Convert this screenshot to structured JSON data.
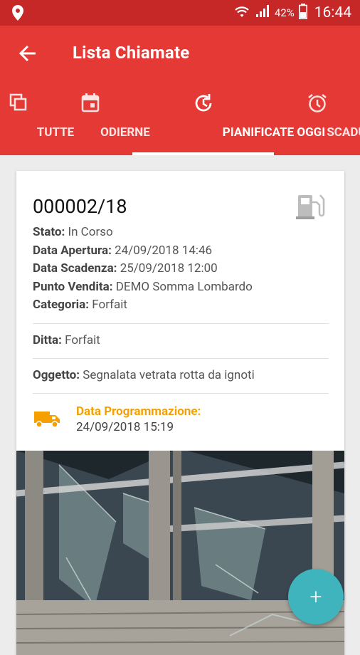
{
  "status_bar": {
    "battery_pct": "42%",
    "time": "16:44"
  },
  "app_bar": {
    "title": "Lista Chiamate"
  },
  "tabs": [
    {
      "label": "TUTTE",
      "icon": "copy-icon"
    },
    {
      "label": "ODIERNE",
      "icon": "calendar-icon"
    },
    {
      "label": "PIANIFICATE OGGI",
      "icon": "history-icon",
      "active": true
    },
    {
      "label": "SCADUTE",
      "icon": "alarm-icon"
    }
  ],
  "card": {
    "code": "000002/18",
    "fields": [
      {
        "label": "Stato:",
        "value": "In Corso"
      },
      {
        "label": "Data Apertura:",
        "value": "24/09/2018 14:46"
      },
      {
        "label": "Data Scadenza:",
        "value": "25/09/2018 12:00"
      },
      {
        "label": "Punto Vendita:",
        "value": "DEMO Somma Lombardo"
      },
      {
        "label": "Categoria:",
        "value": "Forfait"
      }
    ],
    "ditta": {
      "label": "Ditta:",
      "value": "Forfait"
    },
    "oggetto": {
      "label": "Oggetto:",
      "value": "Segnalata vetrata rotta da ignoti"
    },
    "schedule": {
      "label": "Data Programmazione:",
      "value": "24/09/2018 15:19"
    }
  },
  "fab": {
    "label": "+"
  },
  "colors": {
    "primary": "#e53935",
    "status_bar": "#c62828",
    "accent": "#f5a000",
    "fab": "#3fb4bd"
  }
}
